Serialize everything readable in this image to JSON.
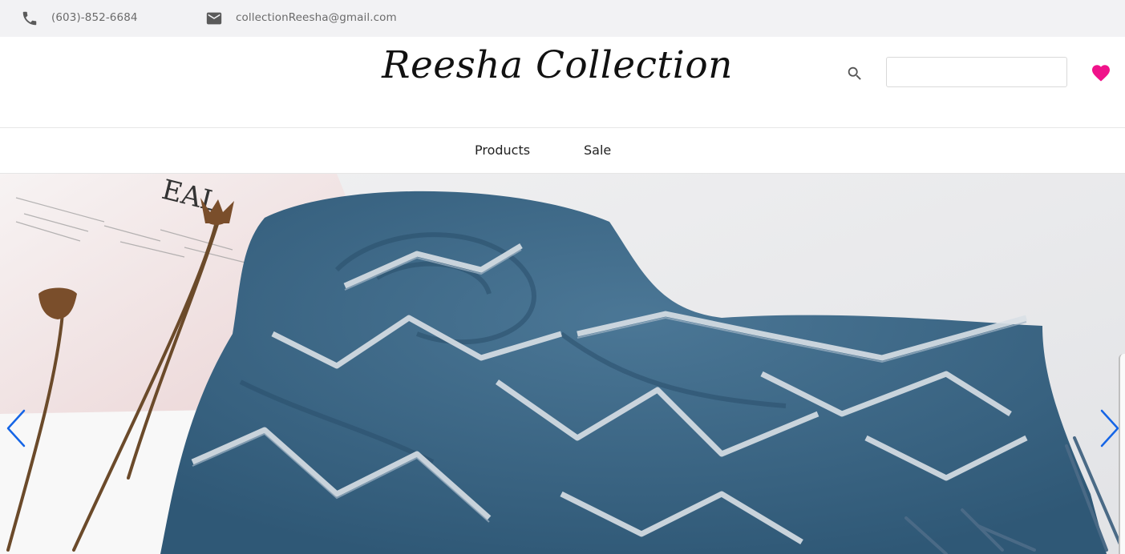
{
  "topbar": {
    "phone": "(603)-852-6684",
    "email": "collectionReesha@gmail.com",
    "phone_icon": "phone-icon",
    "mail_icon": "mail-icon"
  },
  "header": {
    "brand": "Reesha Collection",
    "search_icon": "search-icon",
    "search_value": "",
    "favorites_icon": "heart-icon",
    "heart_color": "#f0128a"
  },
  "nav": {
    "items": [
      {
        "label": "Products"
      },
      {
        "label": "Sale"
      }
    ]
  },
  "hero": {
    "image": "blue patterned scarf on white backdrop",
    "backdrop_text": "EAL",
    "prev_icon": "chevron-left-icon",
    "next_icon": "chevron-right-icon",
    "arrow_color": "#1565e6"
  }
}
